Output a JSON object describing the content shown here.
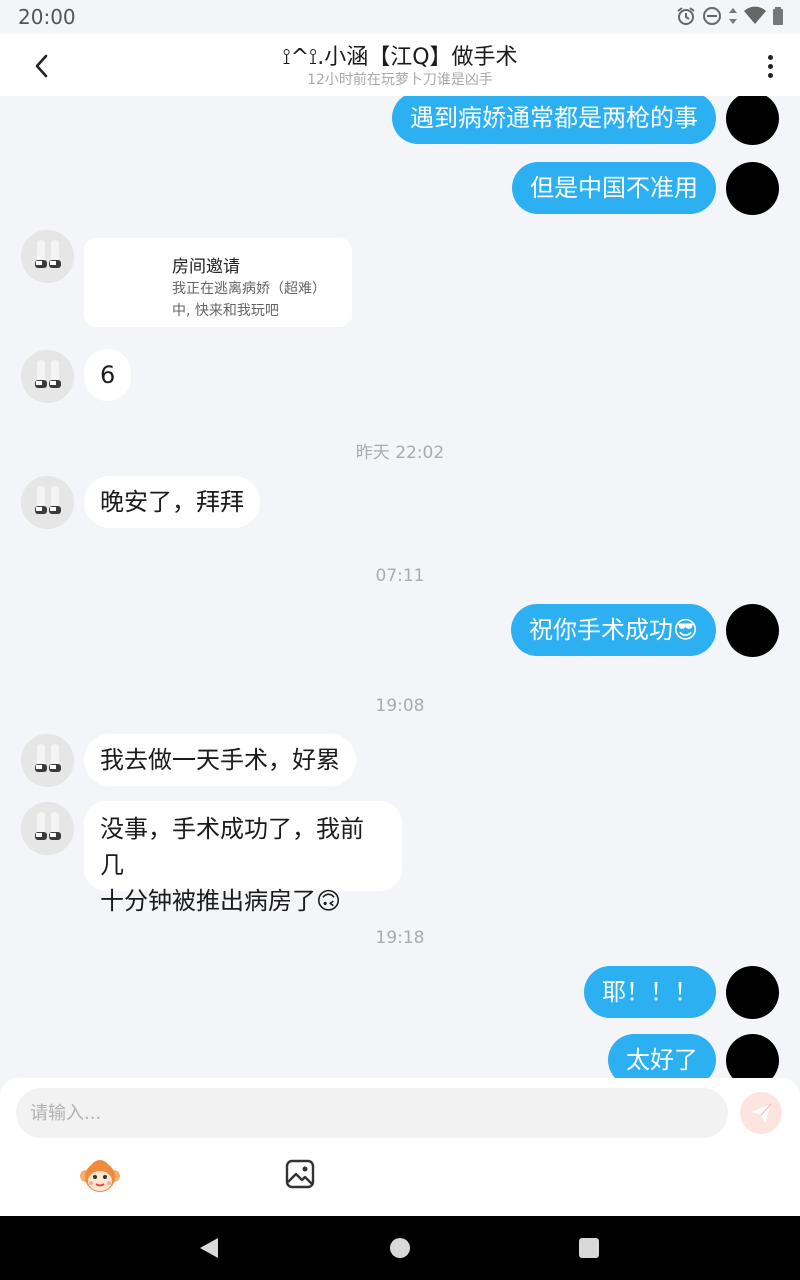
{
  "status_bar": {
    "time": "20:00"
  },
  "header": {
    "title": "⟟^⟟.小涵【江Q】做手术",
    "subtitle": "12小时前在玩萝卜刀谁是凶手"
  },
  "messages": {
    "m1": "遇到病娇通常都是两枪的事",
    "m2": "但是中国不准用",
    "card_title": "房间邀请",
    "card_desc": "我正在逃离病娇（超难）中, 快来和我玩吧",
    "m3": "6",
    "ts1": "昨天 22:02",
    "m4": "晚安了，拜拜",
    "ts2": "07:11",
    "m5": "祝你手术成功😎",
    "ts3": "19:08",
    "m6": "我去做一天手术，好累",
    "m7_line1": "没事，手术成功了，我前几",
    "m7_line2": "十分钟被推出病房了🙃",
    "ts4": "19:18",
    "m8": "耶！！！",
    "m9": "太好了"
  },
  "input": {
    "placeholder": "请输入..."
  },
  "icons": {
    "back": "chevron-left-icon",
    "more": "more-vertical-icon",
    "send": "send-icon",
    "emoji": "monkey-emoji-icon",
    "image": "image-icon"
  },
  "colors": {
    "my_bubble": "#2db0f2",
    "their_bubble": "#ffffff",
    "chat_bg": "#f3f5f8",
    "send_btn_bg": "#fde4df"
  }
}
